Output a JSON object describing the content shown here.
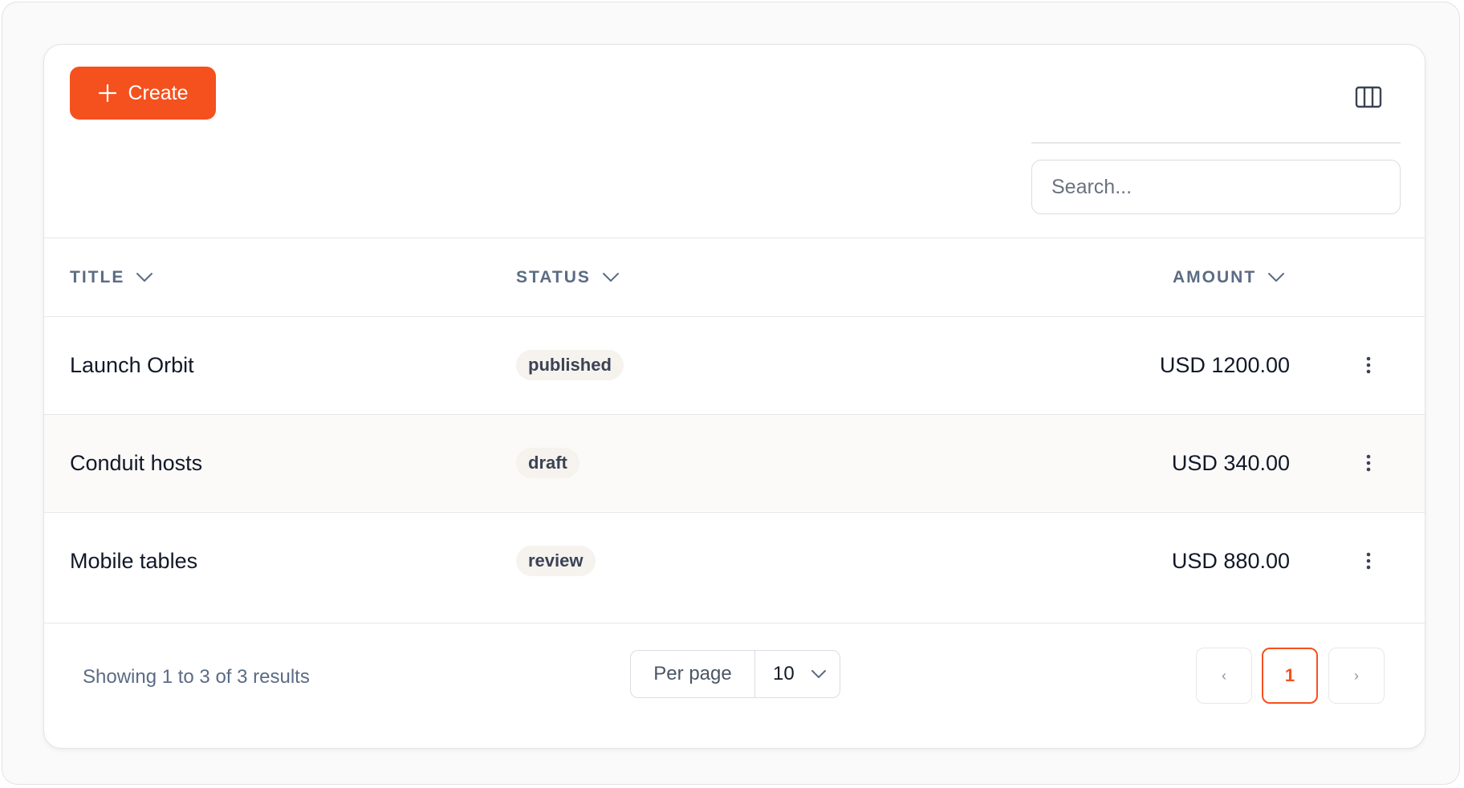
{
  "toolbar": {
    "create_label": "Create",
    "columns_icon": "columns-icon"
  },
  "search": {
    "placeholder": "Search...",
    "value": ""
  },
  "table": {
    "columns": [
      {
        "label": "TITLE",
        "sort_icon": "chevron-down-icon"
      },
      {
        "label": "STATUS",
        "sort_icon": "chevron-down-icon"
      },
      {
        "label": "AMOUNT",
        "sort_icon": "chevron-down-icon"
      }
    ],
    "rows": [
      {
        "title": "Launch Orbit",
        "status": "published",
        "amount": "USD 1200.00"
      },
      {
        "title": "Conduit hosts",
        "status": "draft",
        "amount": "USD 340.00"
      },
      {
        "title": "Mobile tables",
        "status": "review",
        "amount": "USD 880.00"
      }
    ],
    "row_action_icon": "kebab-menu-icon"
  },
  "footer": {
    "showing_text": "Showing 1 to 3 of 3 results",
    "per_page_label": "Per page",
    "per_page_value": "10",
    "pagination": {
      "prev_label": "‹",
      "current_page": "1",
      "next_label": "›"
    }
  },
  "colors": {
    "accent": "#f4511e",
    "header_text": "#5b6b84",
    "badge_bg": "#f6f3ef",
    "alt_row_bg": "#fbfaf8"
  }
}
